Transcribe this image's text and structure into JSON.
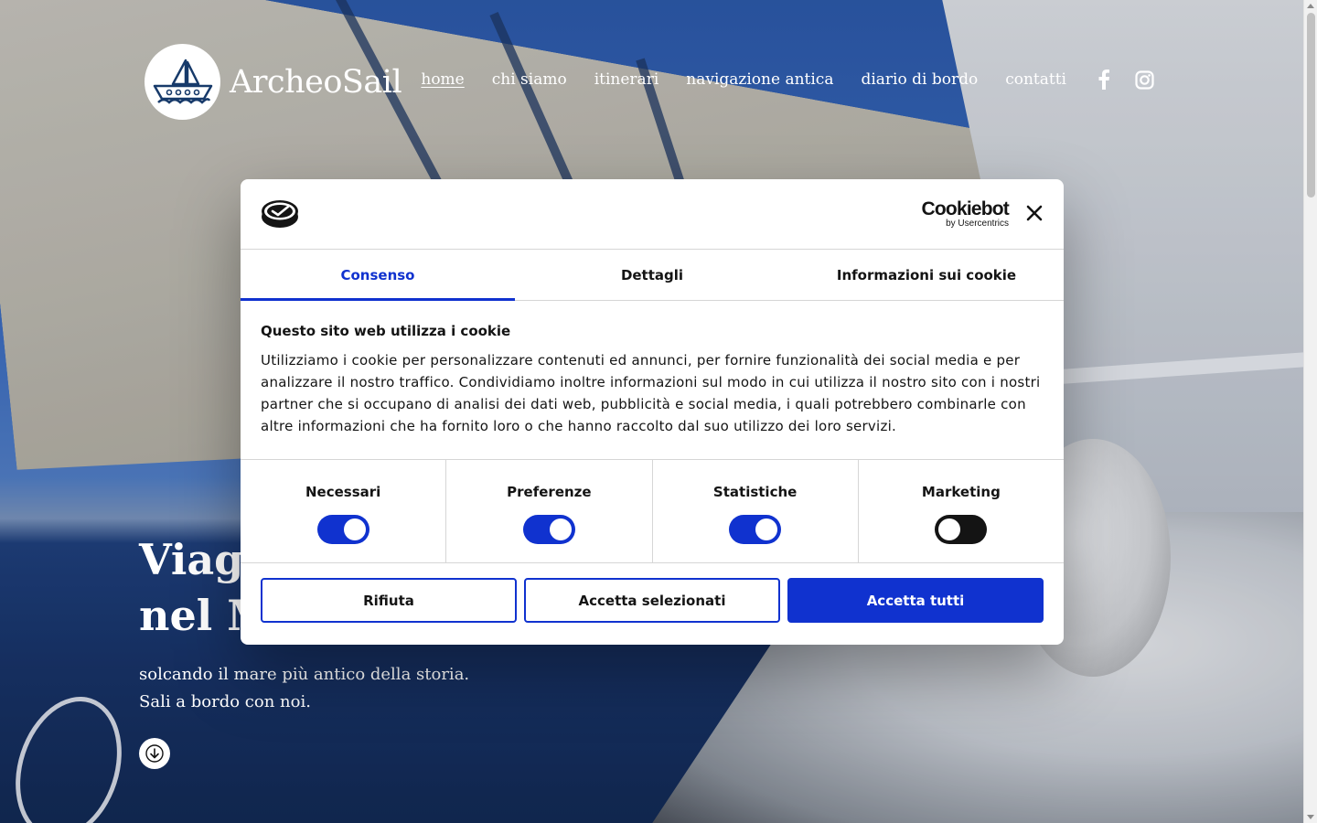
{
  "site": {
    "logo_text": "ArcheoSail",
    "nav": [
      {
        "label": "home",
        "active": true
      },
      {
        "label": "chi siamo"
      },
      {
        "label": "itinerari"
      },
      {
        "label": "navigazione antica"
      },
      {
        "label": "diario di bordo"
      },
      {
        "label": "contatti"
      }
    ],
    "social_icons": [
      "facebook-icon",
      "instagram-icon"
    ]
  },
  "hero": {
    "title_line1": "Viagg",
    "title_line2": "nel M",
    "subtitle_line1": "solcando il mare più antico della storia.",
    "subtitle_line2": "Sali a bordo con noi.",
    "scroll_icon": "arrow-down-icon"
  },
  "cookie_dialog": {
    "brand_main": "Cookiebot",
    "brand_sub": "by Usercentrics",
    "tabs": [
      {
        "label": "Consenso",
        "active": true
      },
      {
        "label": "Dettagli"
      },
      {
        "label": "Informazioni sui cookie"
      }
    ],
    "heading": "Questo sito web utilizza i cookie",
    "body": "Utilizziamo i cookie per personalizzare contenuti ed annunci, per fornire funzionalità dei social media e per analizzare il nostro traffico. Condividiamo inoltre informazioni sul modo in cui utilizza il nostro sito con i nostri partner che si occupano di analisi dei dati web, pubblicità e social media, i quali potrebbero combinarle con altre informazioni che ha fornito loro o che hanno raccolto dal suo utilizzo dei loro servizi.",
    "toggles": [
      {
        "label": "Necessari",
        "on": true
      },
      {
        "label": "Preferenze",
        "on": true
      },
      {
        "label": "Statistiche",
        "on": true
      },
      {
        "label": "Marketing",
        "on": false
      }
    ],
    "buttons": {
      "reject": "Rifiuta",
      "accept_selected": "Accetta selezionati",
      "accept_all": "Accetta tutti"
    }
  },
  "colors": {
    "accent": "#1032cf",
    "toggle_off": "#141414",
    "text": "#141414"
  }
}
